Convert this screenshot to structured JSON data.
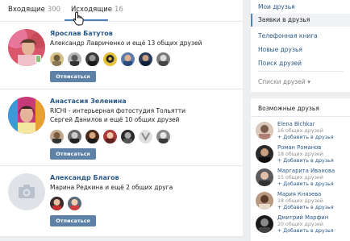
{
  "tabs": {
    "incoming_label": "Входящие",
    "incoming_count": "300",
    "outgoing_label": "Исходящие",
    "outgoing_count": "16"
  },
  "requests": [
    {
      "name": "Ярослав Батутов",
      "lines": [
        "Александр Лавриченко и ещё 13 общих друзей"
      ],
      "button": "Отписаться"
    },
    {
      "name": "Анастасия Зеленина",
      "lines": [
        "RICHI - интерьерная фотостудия Тольятти",
        "Сергей Данилов и ещё 10 общих друзей"
      ],
      "button": "Отписаться"
    },
    {
      "name": "Александр Благов",
      "lines": [
        "Марина Редкина и ещё 2 общих друга"
      ],
      "button": "Отписаться"
    }
  ],
  "menu": {
    "items": [
      "Мои друзья",
      "Заявки в друзья",
      "Телефонная книга",
      "Новые друзья",
      "Поиск друзей"
    ],
    "lists_label": "Списки друзей",
    "lists_arrow": "▾"
  },
  "possible": {
    "title": "Возможные друзья",
    "items": [
      {
        "name": "Elena Bichkar",
        "count": "16 общих друзей",
        "add": "+ Добавить в друзья"
      },
      {
        "name": "Роман Романов",
        "count": "18 общих друзей",
        "add": "+ Добавить в друзья"
      },
      {
        "name": "Маргарита Иванова",
        "count": "15 общих друзей",
        "add": "+ Добавить в друзья"
      },
      {
        "name": "Мария Князева",
        "count": "18 общих друзей",
        "add": "+ Добавить в друзья"
      },
      {
        "name": "Дмитрий Марфин",
        "count": "20 общих друзей",
        "add": "+ Добавить в друзья"
      }
    ]
  },
  "colors": {
    "accent": "#5181b8",
    "link": "#2a5885",
    "button": "#5e81a8",
    "background": "#edeef0",
    "online": "#8ac176"
  }
}
